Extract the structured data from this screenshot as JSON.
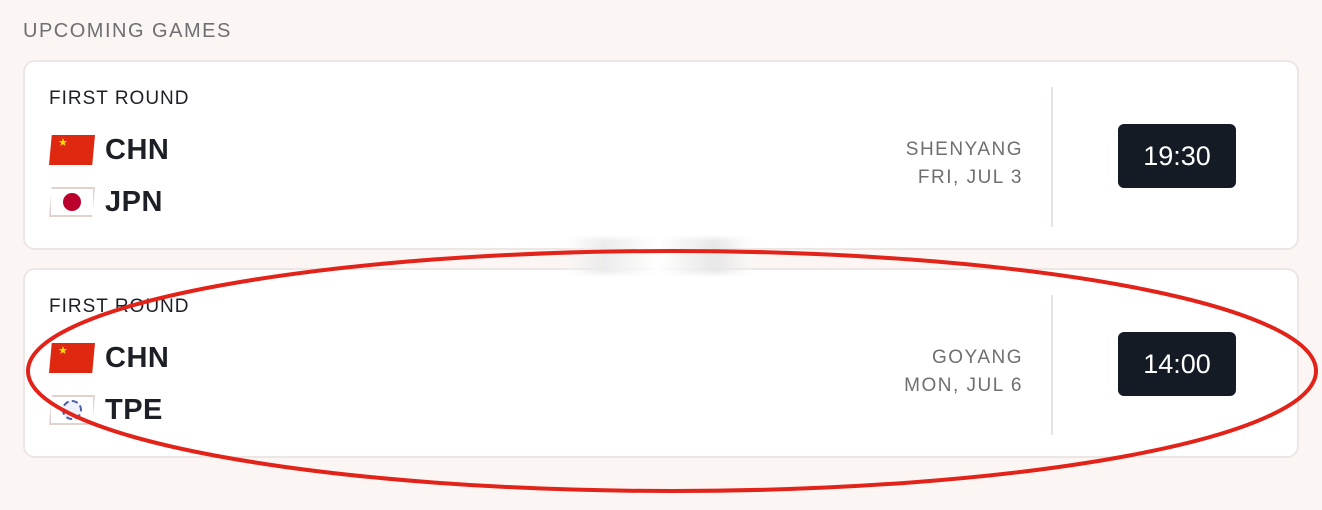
{
  "section": {
    "title": "UPCOMING GAMES"
  },
  "games": [
    {
      "round": "FIRST ROUND",
      "team1": {
        "code": "CHN",
        "flag": "china-flag-icon"
      },
      "team2": {
        "code": "JPN",
        "flag": "japan-flag-icon"
      },
      "city": "SHENYANG",
      "date": "FRI, JUL 3",
      "time": "19:30"
    },
    {
      "round": "FIRST ROUND",
      "team1": {
        "code": "CHN",
        "flag": "china-flag-icon"
      },
      "team2": {
        "code": "TPE",
        "flag": "chinese-taipei-flag-icon"
      },
      "city": "GOYANG",
      "date": "MON, JUL 6",
      "time": "14:00"
    }
  ],
  "colors": {
    "background": "#fbf6f3",
    "card": "#ffffff",
    "time_button": "#141b25",
    "annotation": "#e2231a"
  }
}
